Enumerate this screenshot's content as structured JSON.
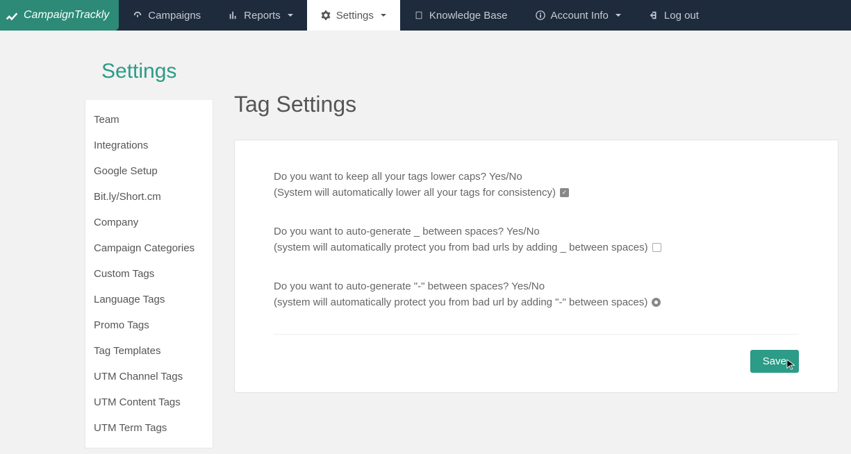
{
  "logo": {
    "text": "CampaignTrackly"
  },
  "nav": {
    "campaigns": "Campaigns",
    "reports": "Reports",
    "settings": "Settings",
    "knowledge_base": "Knowledge Base",
    "account_info": "Account Info",
    "log_out": "Log out"
  },
  "page_title": "Settings",
  "sidebar": {
    "items": [
      {
        "label": "Team"
      },
      {
        "label": "Integrations"
      },
      {
        "label": "Google Setup"
      },
      {
        "label": "Bit.ly/Short.cm"
      },
      {
        "label": "Company"
      },
      {
        "label": "Campaign Categories"
      },
      {
        "label": "Custom Tags"
      },
      {
        "label": "Language Tags"
      },
      {
        "label": "Promo Tags"
      },
      {
        "label": "Tag Templates"
      },
      {
        "label": "UTM Channel Tags"
      },
      {
        "label": "UTM Content Tags"
      },
      {
        "label": "UTM Term Tags"
      }
    ]
  },
  "main": {
    "title": "Tag Settings",
    "settings": [
      {
        "question": "Do you want to keep all your tags lower caps? Yes/No",
        "help": "(System will automatically lower all your tags for consistency)",
        "state": "checked"
      },
      {
        "question": "Do you want to auto-generate _ between spaces? Yes/No",
        "help": "(system will automatically protect you from bad urls by adding _ between spaces)",
        "state": "unchecked"
      },
      {
        "question": "Do you want to auto-generate \"-\" between spaces? Yes/No",
        "help": "(system will automatically protect you from bad url by adding \"-\" between spaces)",
        "state": "radio-filled"
      }
    ],
    "save_label": "Save"
  }
}
